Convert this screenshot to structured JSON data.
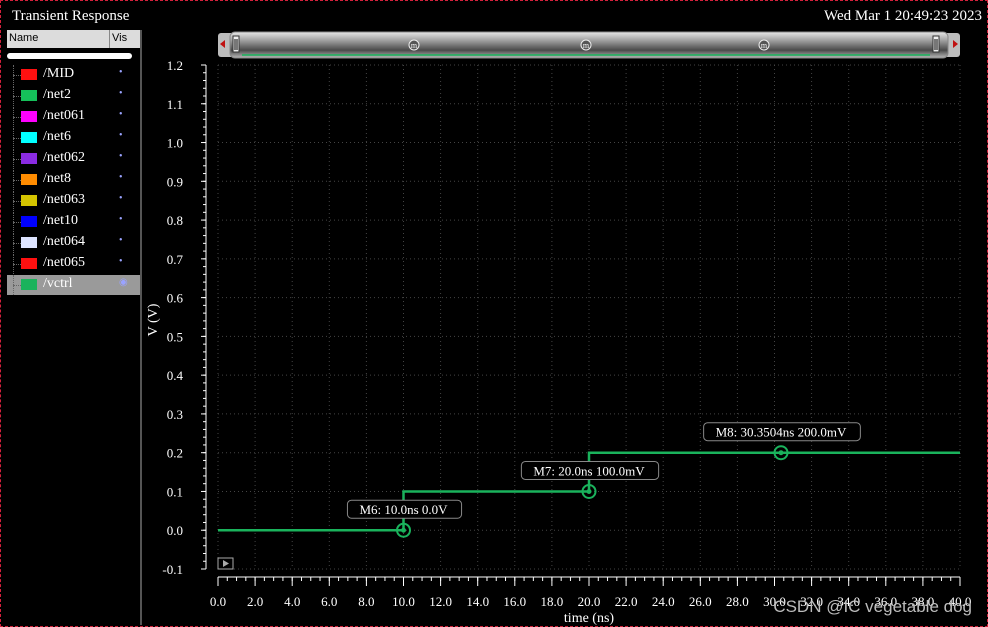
{
  "window": {
    "title": "Transient Response",
    "date": "Wed Mar 1 20:49:23 2023"
  },
  "sidebar": {
    "header": {
      "name": "Name",
      "vis": "Vis"
    },
    "signals": [
      {
        "name": "/MID",
        "color": "#ff1010"
      },
      {
        "name": "/net2",
        "color": "#15c05a"
      },
      {
        "name": "/net061",
        "color": "#ff00ff"
      },
      {
        "name": "/net6",
        "color": "#00ffff"
      },
      {
        "name": "/net062",
        "color": "#8a2be2"
      },
      {
        "name": "/net8",
        "color": "#ff8c00"
      },
      {
        "name": "/net063",
        "color": "#d4c400"
      },
      {
        "name": "/net10",
        "color": "#0000ff"
      },
      {
        "name": "/net064",
        "color": "#dde4ff"
      },
      {
        "name": "/net065",
        "color": "#ff1010"
      },
      {
        "name": "/vctrl",
        "color": "#1ab35c",
        "selected": true
      }
    ]
  },
  "markers_on_scrollbar": [
    "m",
    "m",
    "m"
  ],
  "chart_data": {
    "type": "line",
    "xlabel": "time (ns)",
    "ylabel": "V (V)",
    "xlim": [
      0,
      40
    ],
    "ylim": [
      -0.1,
      1.2
    ],
    "xticks": [
      "0.0",
      "2.0",
      "4.0",
      "6.0",
      "8.0",
      "10.0",
      "12.0",
      "14.0",
      "16.0",
      "18.0",
      "20.0",
      "22.0",
      "24.0",
      "26.0",
      "28.0",
      "30.0",
      "32.0",
      "34.0",
      "36.0",
      "38.0",
      "40.0"
    ],
    "yticks": [
      "-0.1",
      "0.0",
      "0.1",
      "0.2",
      "0.3",
      "0.4",
      "0.5",
      "0.6",
      "0.7",
      "0.8",
      "0.9",
      "1.0",
      "1.1",
      "1.2"
    ],
    "grid": true,
    "series": [
      {
        "name": "/vctrl",
        "color": "#1ab35c",
        "x": [
          0,
          10,
          10,
          20,
          20,
          40
        ],
        "y": [
          0.0,
          0.0,
          0.1,
          0.1,
          0.2,
          0.2
        ]
      }
    ],
    "markers": [
      {
        "label": "M6: 10.0ns 0.0V",
        "x": 10.0,
        "y": 0.0
      },
      {
        "label": "M7: 20.0ns 100.0mV",
        "x": 20.0,
        "y": 0.1
      },
      {
        "label": "M8: 30.3504ns 200.0mV",
        "x": 30.3504,
        "y": 0.2
      }
    ]
  },
  "watermark": "CSDN @IC vegetable dog"
}
